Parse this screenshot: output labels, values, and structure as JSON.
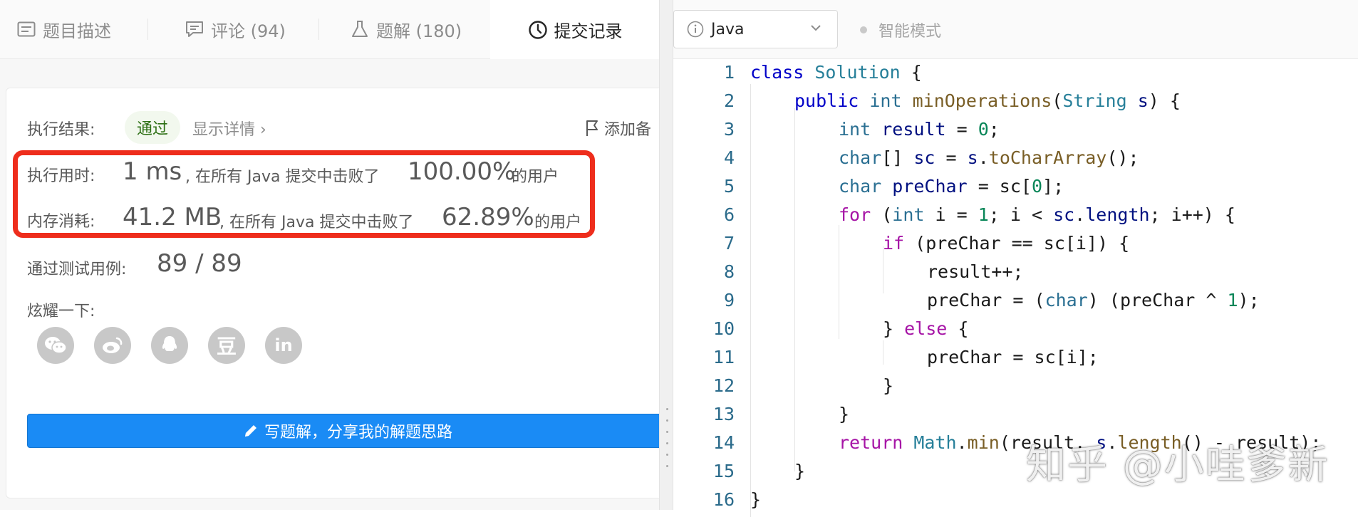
{
  "tabs": [
    {
      "label": "题目描述",
      "icon": "description-icon"
    },
    {
      "label": "评论 (94)",
      "icon": "comment-icon"
    },
    {
      "label": "题解 (180)",
      "icon": "flask-icon"
    },
    {
      "label": "提交记录",
      "icon": "clock-icon"
    }
  ],
  "result": {
    "label": "执行结果:",
    "status": "通过",
    "details_link": "显示详情 ›",
    "add_note": "添加备"
  },
  "runtime": {
    "label": "执行用时:",
    "value": "1 ms",
    "text": ", 在所有 Java 提交中击败了",
    "percent": "100.00%",
    "suffix": "的用户"
  },
  "memory": {
    "label": "内存消耗:",
    "value": "41.2 MB",
    "text": ", 在所有 Java 提交中击败了",
    "percent": "62.89%",
    "suffix": "的用户"
  },
  "tests": {
    "label": "通过测试用例:",
    "value": "89 / 89"
  },
  "share": {
    "label": "炫耀一下:",
    "icons": [
      "wechat-icon",
      "weibo-icon",
      "qq-icon",
      "douban-icon",
      "linkedin-icon"
    ],
    "douban_glyph": "豆",
    "linkedin_glyph": "in"
  },
  "write_button": "写题解，分享我的解题思路",
  "editor": {
    "language": "Java",
    "mode": "智能模式",
    "line_numbers": [
      "1",
      "2",
      "3",
      "4",
      "5",
      "6",
      "7",
      "8",
      "9",
      "10",
      "11",
      "12",
      "13",
      "14",
      "15",
      "16"
    ]
  },
  "watermark": "知乎 @小哇爹新",
  "colors": {
    "accent": "#1a8bf5",
    "highlight": "#ee2d1c",
    "pass_bg": "#f2f8ee"
  }
}
